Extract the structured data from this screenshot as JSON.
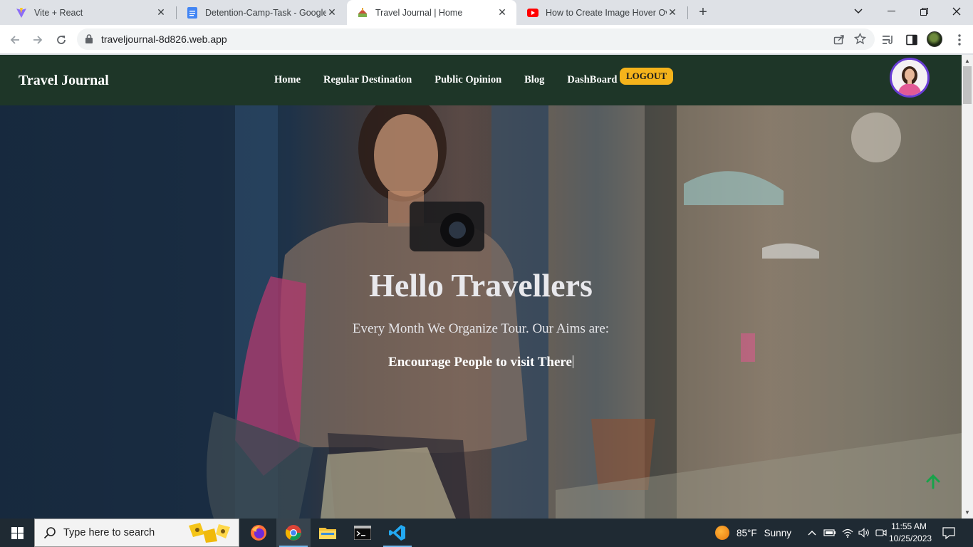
{
  "browser": {
    "tabs": [
      {
        "title": "Vite + React",
        "icon": "vite-icon",
        "active": false
      },
      {
        "title": "Detention-Camp-Task - Google D",
        "icon": "google-docs-icon",
        "active": false
      },
      {
        "title": "Travel Journal | Home",
        "icon": "travel-journal-favicon",
        "active": true
      },
      {
        "title": "How to Create Image Hover Ove",
        "icon": "youtube-icon",
        "active": false
      }
    ],
    "url": "traveljournal-8d826.web.app"
  },
  "navbar": {
    "brand": "Travel Journal",
    "links": [
      "Home",
      "Regular Destination",
      "Public Opinion",
      "Blog",
      "DashBoard"
    ],
    "logout_label": "LOGOUT"
  },
  "hero": {
    "title": "Hello Travellers",
    "subtitle": "Every Month We Organize Tour. Our Aims are:",
    "typed_text": "Encourage People to visit There"
  },
  "taskbar": {
    "search_placeholder": "Type here to search",
    "weather_temp": "85°F",
    "weather_condition": "Sunny",
    "time": "11:55 AM",
    "date": "10/25/2023"
  },
  "colors": {
    "navbar_bg": "#1e3628",
    "logout_bg": "#f5b31b",
    "avatar_ring": "#6a3dd6",
    "scroll_top_arrow": "#17a34a"
  }
}
